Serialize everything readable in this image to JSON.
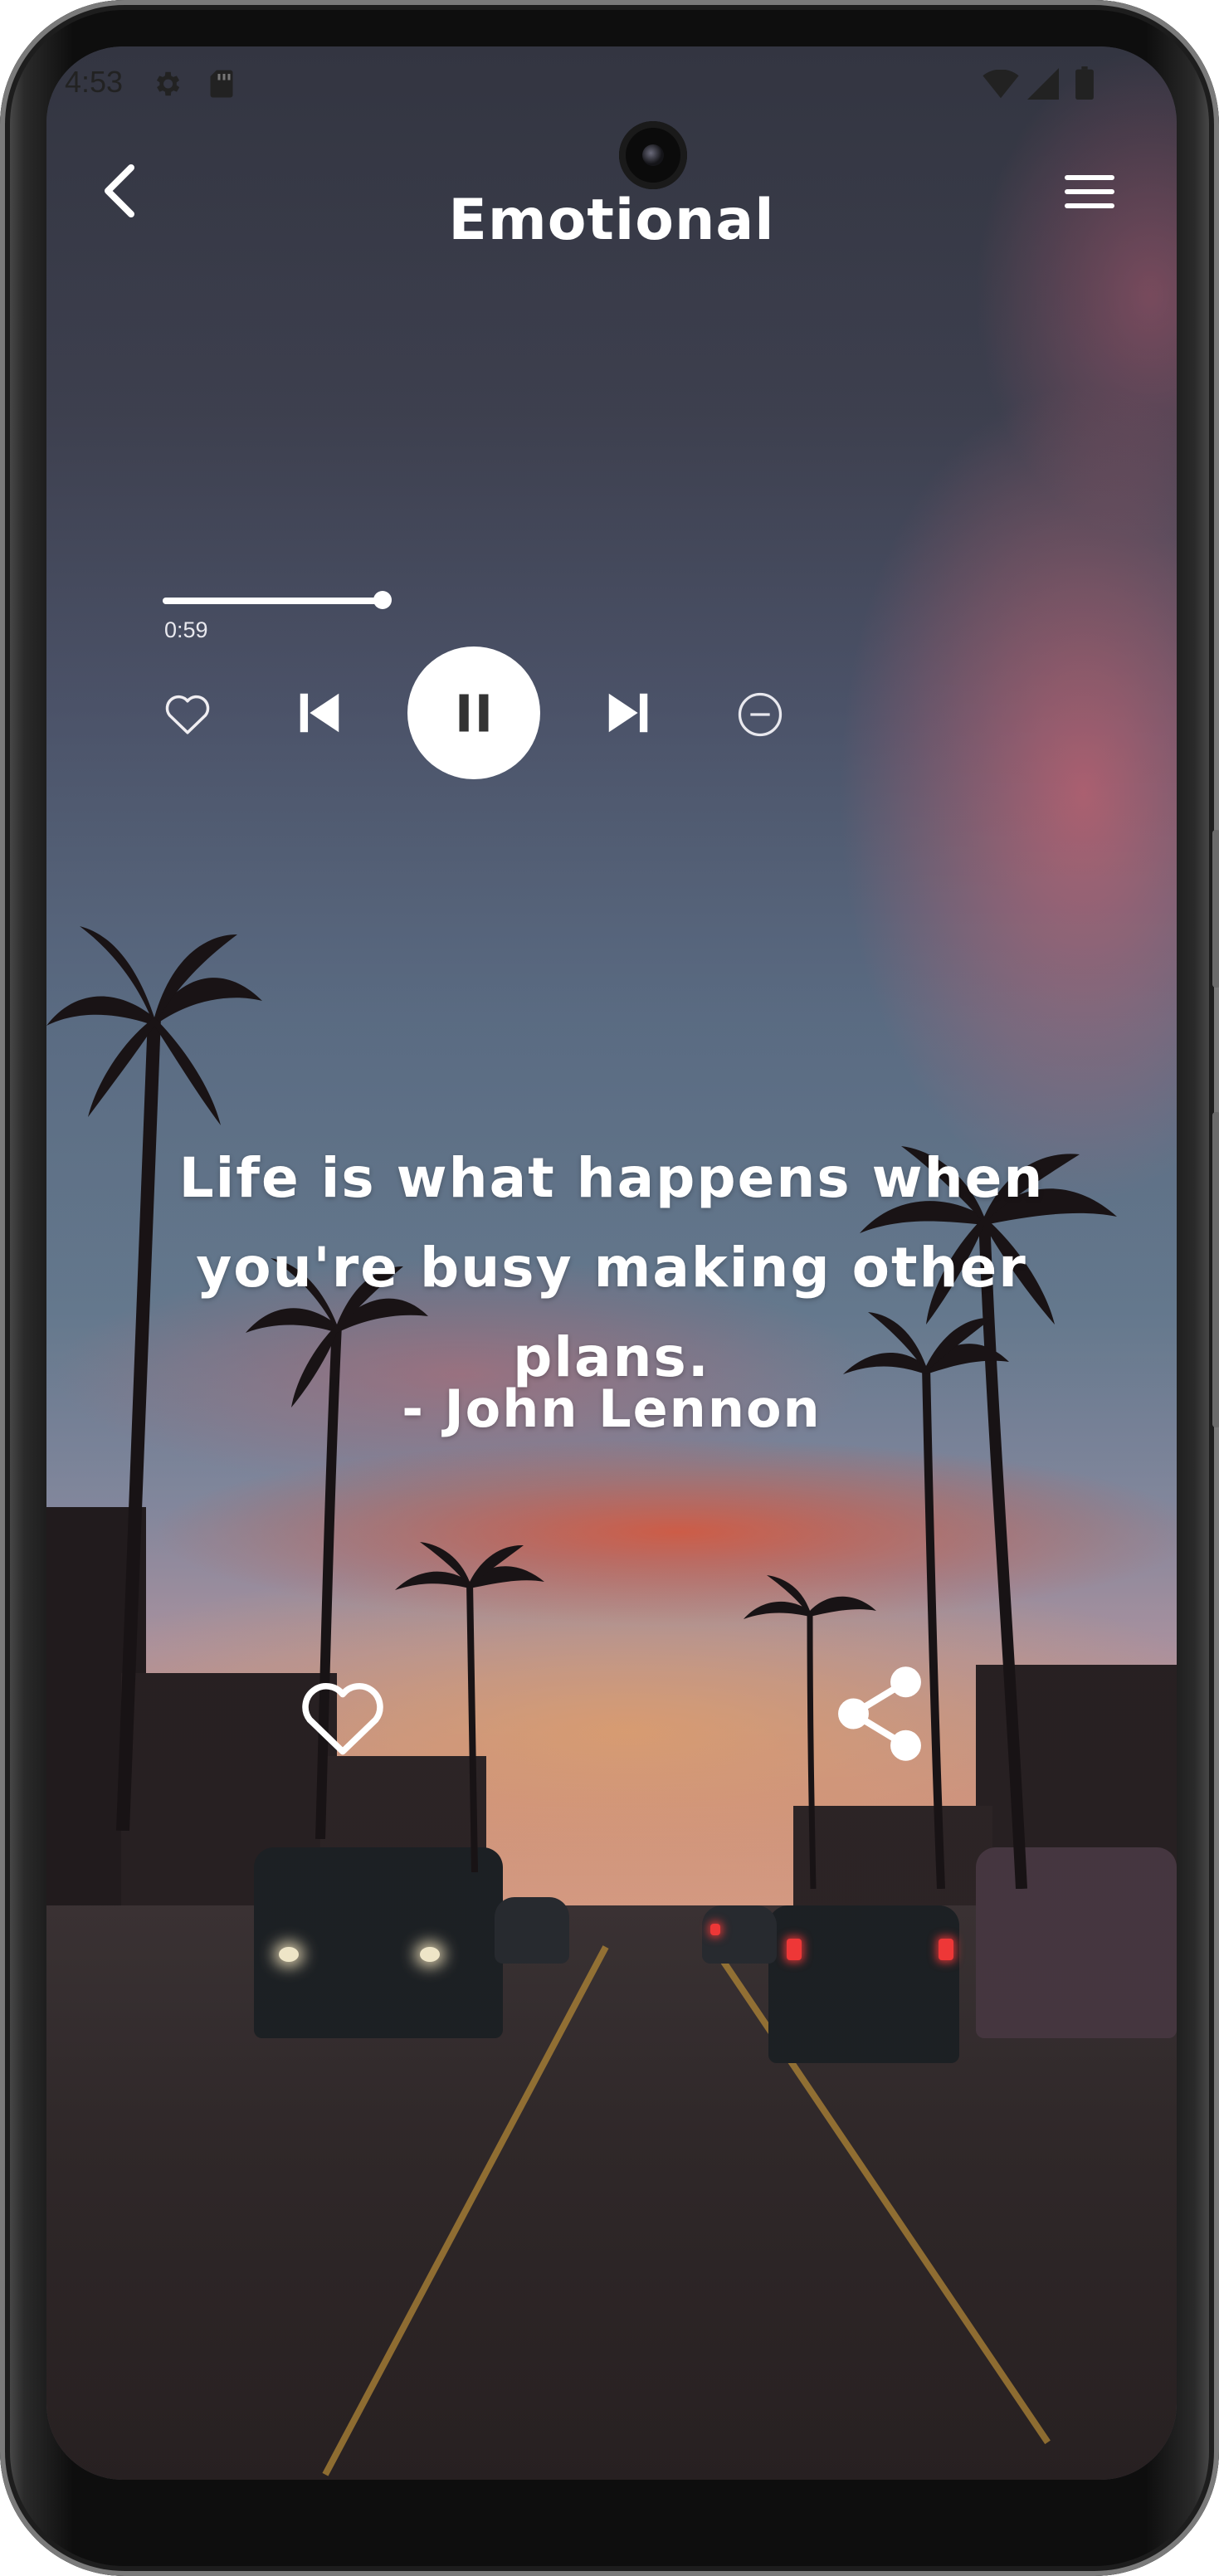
{
  "status_bar": {
    "time": "4:53",
    "left_icons": [
      "settings-icon",
      "sd-card-icon"
    ],
    "right_icons": [
      "wifi-icon",
      "signal-icon",
      "battery-icon"
    ]
  },
  "app_bar": {
    "title": "Emotional",
    "back_icon": "chevron-left-icon",
    "menu_icon": "hamburger-menu-icon"
  },
  "player": {
    "elapsed": "0:59",
    "progress_fraction": 1.0,
    "controls": [
      "heart-outline-icon",
      "skip-previous-icon",
      "pause-icon",
      "skip-next-icon",
      "minus-circle-icon"
    ],
    "state": "playing"
  },
  "quote": {
    "text": "Life is what happens when you're busy making other plans.",
    "author": "-  John Lennon"
  },
  "actions": {
    "favorite_icon": "heart-outline-icon",
    "share_icon": "share-icon"
  },
  "colors": {
    "foreground": "#ffffff",
    "status_text": "#222222"
  }
}
